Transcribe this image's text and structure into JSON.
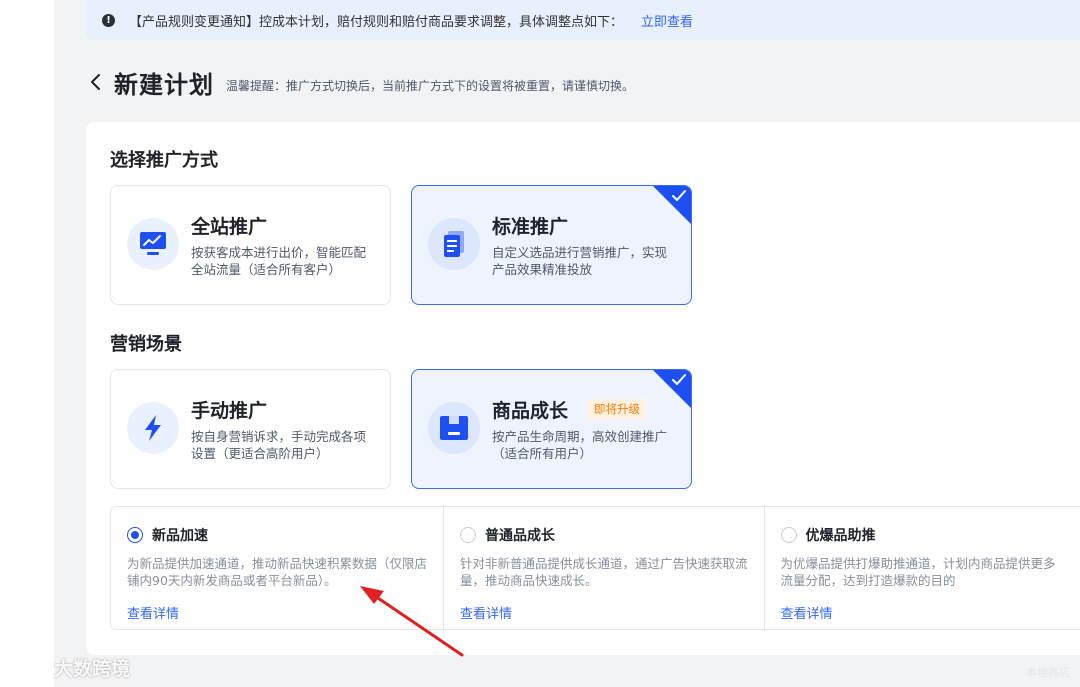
{
  "notice": {
    "text": "【产品规则变更通知】控成本计划，赔付规则和赔付商品要求调整，具体调整点如下：",
    "link": "立即查看"
  },
  "header": {
    "title": "新建计划",
    "tip": "温馨提醒：推广方式切换后，当前推广方式下的设置将被重置，请谨慎切换。"
  },
  "promotion": {
    "section_title": "选择推广方式",
    "options": [
      {
        "title": "全站推广",
        "desc": "按获客成本进行出价，智能匹配全站流量（适合所有客户）",
        "selected": false,
        "icon": "chart-monitor-icon"
      },
      {
        "title": "标准推广",
        "desc": "自定义选品进行营销推广，实现产品效果精准投放",
        "selected": true,
        "icon": "document-icon"
      }
    ]
  },
  "marketing": {
    "section_title": "营销场景",
    "options": [
      {
        "title": "手动推广",
        "desc": "按自身营销诉求，手动完成各项设置（更适合高阶用户）",
        "selected": false,
        "icon": "lightning-icon"
      },
      {
        "title": "商品成长",
        "badge": "即将升级",
        "desc": "按产品生命周期，高效创建推广（适合所有用户）",
        "selected": true,
        "icon": "box-icon"
      }
    ]
  },
  "scenes": [
    {
      "title": "新品加速",
      "selected": true,
      "desc_line1": "为新品提供加速通道，推动新品快速积累数据（仅限店",
      "desc_line2": "铺内90天内新发商品或者平台新品）。",
      "link": "查看详情"
    },
    {
      "title": "普通品成长",
      "selected": false,
      "desc_line1": "针对非新普通品提供成长通道，通过广告快速获取流",
      "desc_line2": "量，推动商品快速成长。",
      "link": "查看详情"
    },
    {
      "title": "优爆品助推",
      "selected": false,
      "desc_line1": "为优爆品提供打爆助推通道，计划内商品提供更多",
      "desc_line2": "流量分配，达到打造爆款的目的",
      "link": "查看详情"
    }
  ],
  "watermark": {
    "text": "大数跨境"
  },
  "footer_faint": "本地商店",
  "colors": {
    "accent": "#1d4ff2",
    "link": "#3366ff",
    "annotation_arrow": "#e02020",
    "badge": "#ff7d00"
  }
}
